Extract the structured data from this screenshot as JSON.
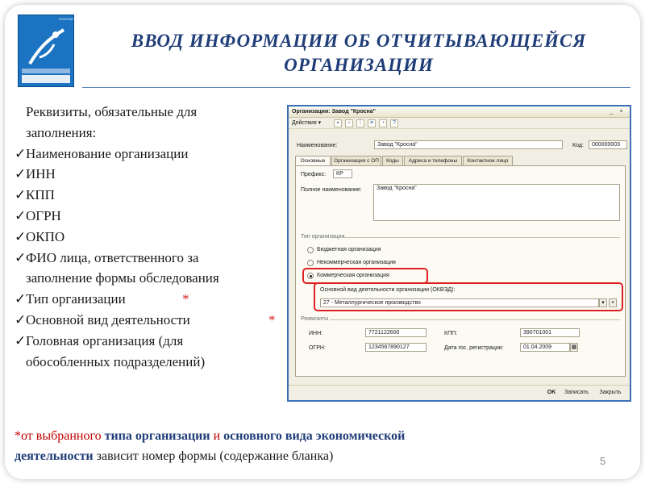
{
  "slide": {
    "title_line1": "ВВОД ИНФОРМАЦИИ ОБ ОТЧИТЫВАЮЩЕЙСЯ",
    "title_line2": "ОРГАНИЗАЦИИ",
    "page_number": "5",
    "colors": {
      "title": "#1f3d78",
      "accent_red": "#d42020",
      "window_border": "#3d6fb5"
    }
  },
  "logo": {
    "top_text": "РОССТАТ"
  },
  "requisites": {
    "intro_line1": "Реквизиты, обязательные для",
    "intro_line2": "заполнения:",
    "check_glyph": "✓",
    "star_glyph": "*",
    "items": [
      {
        "text": "Наименование организации"
      },
      {
        "text": "ИНН"
      },
      {
        "text": "КПП"
      },
      {
        "text": "ОГРН"
      },
      {
        "text": "ОКПО"
      },
      {
        "text": "ФИО лица, ответственного за",
        "text2": "заполнение формы обследования"
      },
      {
        "text": "Тип организации"
      },
      {
        "text": "Основной вид деятельности"
      },
      {
        "text": "Головная организация (для",
        "text2": "обособленных подразделений)"
      }
    ]
  },
  "footnote": {
    "star": "*",
    "part1": "от выбранного ",
    "part2": "типа организации",
    "part3": " и ",
    "part4": "основного вида экономической",
    "part5": "деятельности",
    "part6": " зависит номер формы (содержание бланка)"
  },
  "window": {
    "title": "Организации: Завод \"Кросна\"",
    "actions_menu": "Действия",
    "name_label": "Наименование:",
    "name_value": "Завод \"Кросна\"",
    "code_label": "Код:",
    "code_value": "000000003",
    "tabs": [
      "Основные",
      "Организация с ОП",
      "Коды",
      "Адреса и телефоны",
      "Контактное лицо"
    ],
    "prefix_label": "Префикс:",
    "prefix_value": "КР",
    "full_name_label": "Полное наименование:",
    "full_name_value": "Завод \"Кросна\"",
    "org_type_group": "Тип организации",
    "org_types": [
      "Бюджетная организация",
      "Некоммерческая организация",
      "Коммерческая организация"
    ],
    "selected_org_type": "Коммерческая организация",
    "okved_label": "Основной вид деятельности организации (ОКВЭД):",
    "okved_value": "27  - Металлургическое производство",
    "requisites_group": "Реквизиты",
    "inn_label": "ИНН:",
    "inn_value": "7721122600",
    "kpp_label": "КПП:",
    "kpp_value": "390701001",
    "ogrn_label": "ОГРН:",
    "ogrn_value": "1234567890127",
    "reg_date_label": "Дата гос. регистрации:",
    "reg_date_value": "01.04.2009",
    "ok_button": "OK",
    "save_button": "Записать",
    "close_button": "Закрыть"
  }
}
